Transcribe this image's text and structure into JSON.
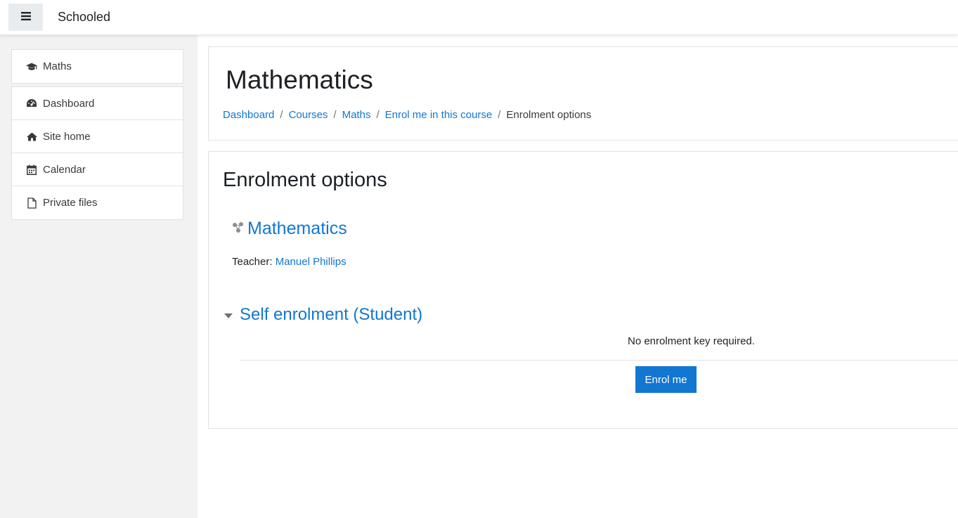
{
  "navbar": {
    "menu_icon": "hamburger-icon",
    "site_name": "Schooled"
  },
  "drawer": {
    "course_item": {
      "icon": "graduation-cap-icon",
      "label": "Maths"
    },
    "items": [
      {
        "icon": "dashboard-icon",
        "label": "Dashboard"
      },
      {
        "icon": "home-icon",
        "label": "Site home"
      },
      {
        "icon": "calendar-icon",
        "label": "Calendar"
      },
      {
        "icon": "file-icon",
        "label": "Private files"
      }
    ]
  },
  "header": {
    "title": "Mathematics",
    "breadcrumb": [
      {
        "label": "Dashboard",
        "link": true
      },
      {
        "label": "Courses",
        "link": true
      },
      {
        "label": "Maths",
        "link": true
      },
      {
        "label": "Enrol me in this course",
        "link": true
      },
      {
        "label": "Enrolment options",
        "link": false
      }
    ],
    "separator": "/"
  },
  "main": {
    "section_title": "Enrolment options",
    "course": {
      "icon": "course-icon",
      "name": "Mathematics",
      "teacher_label": "Teacher:",
      "teacher_name": "Manuel Phillips"
    },
    "self_enrolment": {
      "title": "Self enrolment (Student)",
      "note": "No enrolment key required.",
      "button_label": "Enrol me"
    }
  },
  "colors": {
    "link": "#1177d1",
    "primary_button": "#1177d1",
    "drawer_bg": "#f2f2f2"
  }
}
